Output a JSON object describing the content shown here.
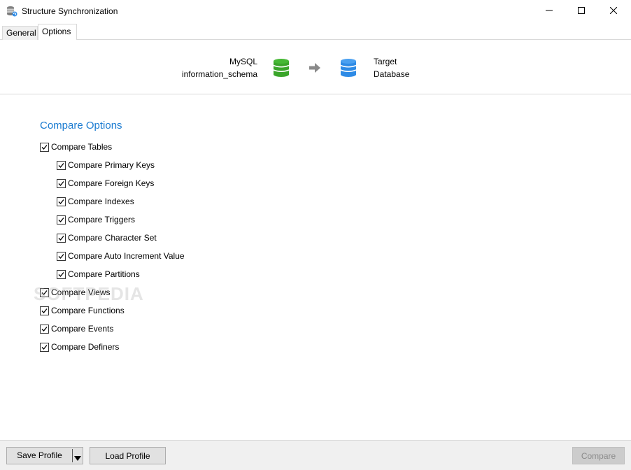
{
  "window": {
    "title": "Structure Synchronization",
    "app_icon": "database-sync-icon",
    "controls": [
      "minimize-icon",
      "maximize-icon",
      "close-icon"
    ]
  },
  "tabs": [
    {
      "label": "General",
      "active": false
    },
    {
      "label": "Options",
      "active": true
    }
  ],
  "header": {
    "source_line1": "MySQL",
    "source_line2": "information_schema",
    "source_icon": "database-icon",
    "source_color": "#3aa52a",
    "arrow_icon": "arrow-right-icon",
    "target_line1": "Target",
    "target_line2": "Database",
    "target_icon": "database-icon",
    "target_color": "#2e8be6"
  },
  "compare_options": {
    "title": "Compare Options",
    "title_color": "#1a7bd1",
    "items": [
      {
        "label": "Compare Tables",
        "checked": true
      },
      {
        "label": "Compare Primary Keys",
        "checked": true
      },
      {
        "label": "Compare Foreign Keys",
        "checked": true
      },
      {
        "label": "Compare Indexes",
        "checked": true
      },
      {
        "label": "Compare Triggers",
        "checked": true
      },
      {
        "label": "Compare Character Set",
        "checked": true
      },
      {
        "label": "Compare Auto Increment Value",
        "checked": true
      },
      {
        "label": "Compare Partitions",
        "checked": true
      },
      {
        "label": "Compare Views",
        "checked": true
      },
      {
        "label": "Compare Functions",
        "checked": true
      },
      {
        "label": "Compare Events",
        "checked": true
      },
      {
        "label": "Compare Definers",
        "checked": true
      }
    ]
  },
  "footer": {
    "save_profile_label": "Save Profile",
    "load_profile_label": "Load Profile",
    "compare_label": "Compare",
    "compare_enabled": false
  },
  "watermark": "SOFTPEDIA"
}
